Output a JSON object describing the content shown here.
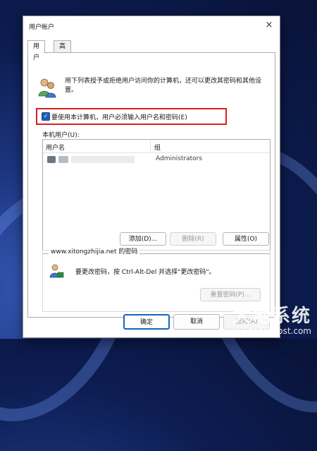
{
  "window": {
    "title": "用户帐户",
    "close_glyph": "×"
  },
  "tabs": [
    {
      "label": "用户",
      "active": true
    },
    {
      "label": "高级",
      "active": false
    }
  ],
  "intro_text": "用下列表授予或拒绝用户访问你的计算机，还可以更改其密码和其他设置。",
  "require_login": {
    "label": "要使用本计算机，用户必须输入用户名和密码(E)",
    "checked": true
  },
  "users_label": "本机用户(U):",
  "list": {
    "columns": [
      "用户名",
      "组"
    ],
    "rows": [
      {
        "username": "",
        "group": "Administrators"
      }
    ]
  },
  "buttons": {
    "add": "添加(D)...",
    "remove": "删除(R)",
    "properties": "属性(O)",
    "reset_password": "重置密码(P)...",
    "ok": "确定",
    "cancel": "取消",
    "apply": "应用(A)"
  },
  "password_group": {
    "title": "www.xitongzhijia.net 的密码",
    "text": "要更改密码，按 Ctrl-Alt-Del 并选择\"更改密码\"。"
  },
  "watermark": {
    "cn": "大地系统",
    "en": "www.dadiGhost.com"
  },
  "colors": {
    "accent": "#1565c0",
    "highlight_border": "#d82020",
    "checkbox_fill": "#1a5fb8"
  }
}
